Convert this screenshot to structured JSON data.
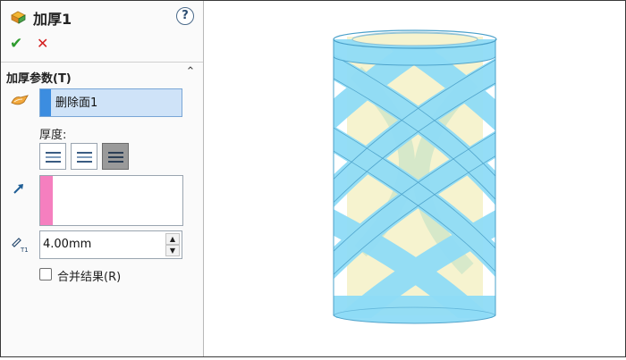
{
  "feature": {
    "title": "加厚1",
    "help_glyph": "?",
    "icon": "thicken-feature-icon"
  },
  "actions": {
    "ok_glyph": "✔",
    "cancel_glyph": "✕"
  },
  "params": {
    "group_title": "加厚参数(T)",
    "collapse_glyph": "⌃",
    "face_list": {
      "item": "删除面1",
      "marker_color": "#3c8de0"
    },
    "thickness_label": "厚度:",
    "thickness_side_selected": 3,
    "direction_marker_color": "#f57fbf",
    "thickness_value": "4.00mm",
    "spin_up": "▲",
    "spin_down": "▼",
    "merge": {
      "label": "合并结果(R)",
      "checked": false
    }
  },
  "model": {
    "description_colors": {
      "body": "#8fdcf7",
      "inner": "#f5f1c4",
      "edge": "#4aa0c9"
    }
  }
}
